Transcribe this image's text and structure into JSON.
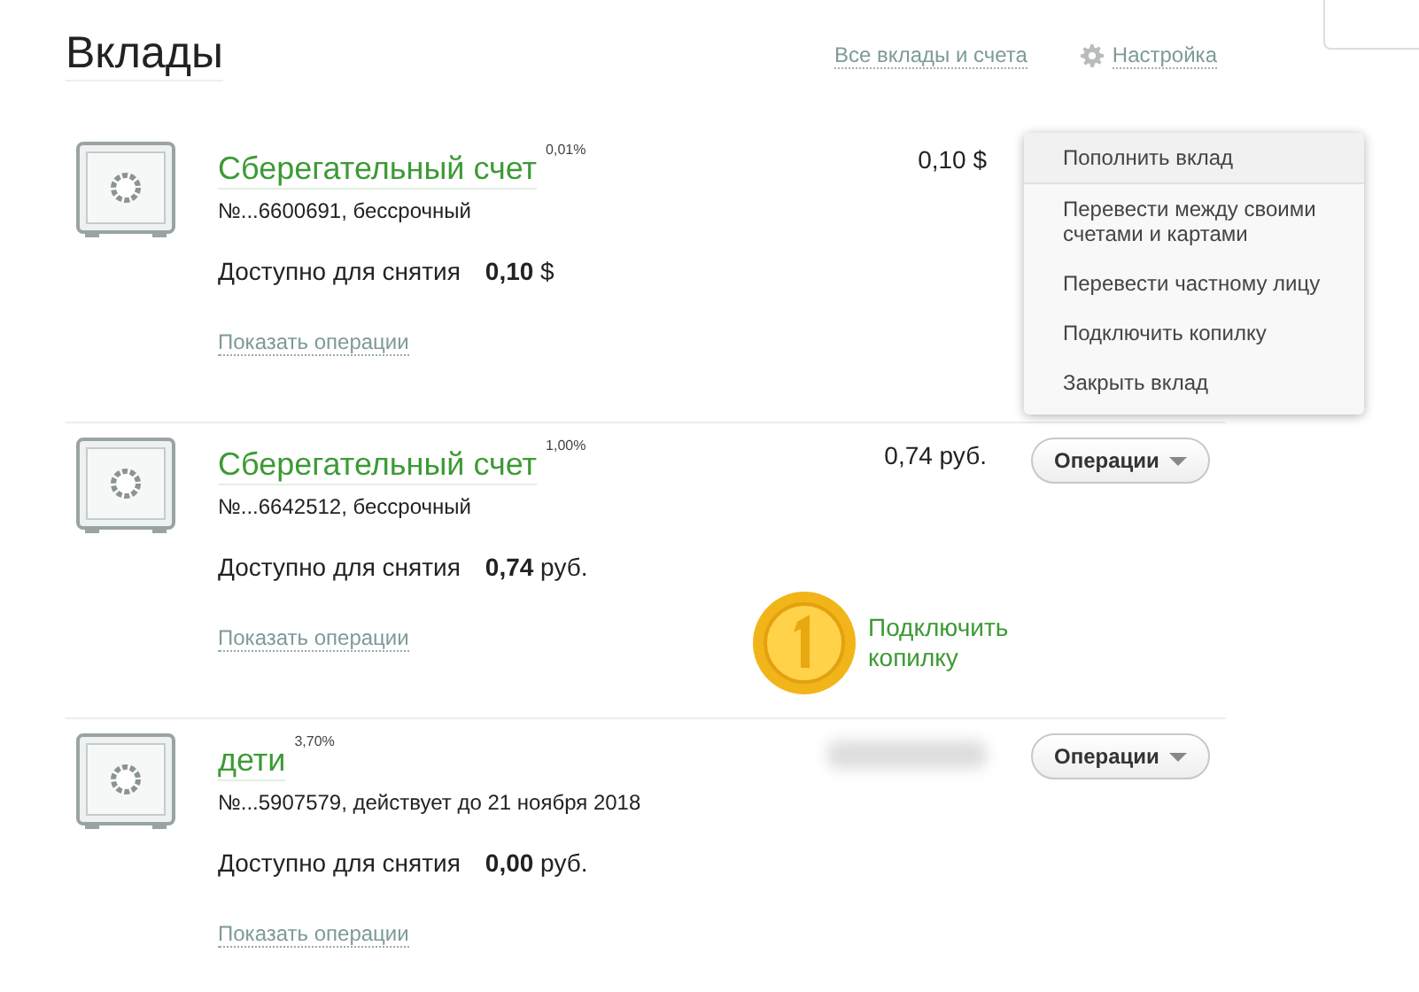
{
  "page": {
    "title": "Вклады",
    "links": [
      {
        "label": "Все вклады и счета",
        "kind": "plain"
      },
      {
        "label": "Настройка",
        "kind": "settings"
      }
    ]
  },
  "accounts": [
    {
      "name": "Сберегательный счет",
      "rate": "0,01%",
      "number": "№...6600691, бессрочный",
      "available_label": "Доступно для снятия",
      "available_amount": "0,10",
      "available_currency": "$",
      "balance": "0,10 $",
      "balance_hidden": false,
      "menu_open": true,
      "link": "Показать операции"
    },
    {
      "name": "Сберегательный счет",
      "rate": "1,00%",
      "number": "№...6642512, бессрочный",
      "available_label": "Доступно для снятия",
      "available_amount": "0,74",
      "available_currency": "руб.",
      "balance": "0,74 руб.",
      "balance_hidden": false,
      "button": "Операции",
      "menu_open": false,
      "link": "Показать операции",
      "promo": "Подключить копилку"
    },
    {
      "name": "дети",
      "rate": "3,70%",
      "number": "№...5907579, действует до 21 ноября 2018",
      "available_label": "Доступно для снятия",
      "available_amount": "0,00",
      "available_currency": "руб.",
      "balance_hidden": true,
      "button": "Операции",
      "menu_open": false,
      "link": "Показать операции"
    }
  ],
  "operations_menu": [
    {
      "label": "Пополнить вклад",
      "selected": true
    },
    {
      "label": "Перевести между своими счетами и картами",
      "selected": false
    },
    {
      "label": "Перевести частному лицу",
      "selected": false
    },
    {
      "label": "Подключить копилку",
      "selected": false
    },
    {
      "label": "Закрыть вклад",
      "selected": false
    }
  ]
}
